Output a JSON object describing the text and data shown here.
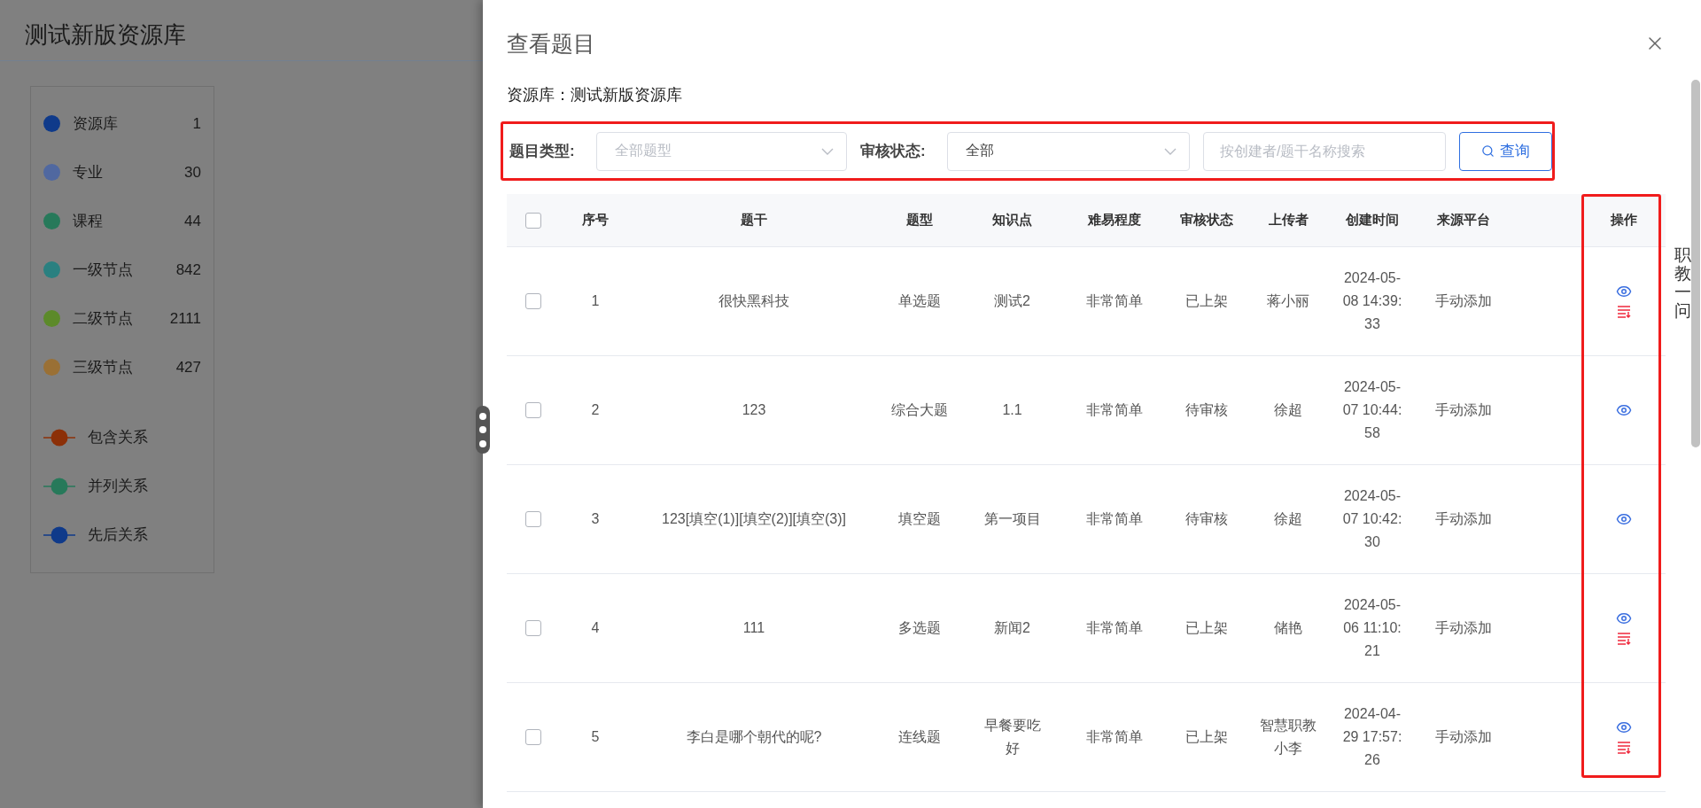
{
  "page": {
    "title": "测试新版资源库",
    "nodes": [
      {
        "label": "资源库",
        "count": "1",
        "color": "#0f3a8a"
      },
      {
        "label": "专业",
        "count": "30",
        "color": "#5068a0"
      },
      {
        "label": "课程",
        "count": "44",
        "color": "#27795a"
      },
      {
        "label": "一级节点",
        "count": "842",
        "color": "#2a8080"
      },
      {
        "label": "二级节点",
        "count": "2111",
        "color": "#5c8a2a"
      },
      {
        "label": "三级节点",
        "count": "427",
        "color": "#9a7035"
      }
    ],
    "relations": [
      {
        "label": "包含关系",
        "color": "#8c3008"
      },
      {
        "label": "并列关系",
        "color": "#27795a"
      },
      {
        "label": "先后关系",
        "color": "#0f3a8a"
      }
    ]
  },
  "drawer": {
    "title": "查看题目",
    "library": "资源库：测试新版资源库",
    "filters": {
      "highlighted": true,
      "type_label": "题目类型:",
      "type_placeholder": "全部题型",
      "status_label": "审核状态:",
      "status_value": "全部",
      "search_placeholder": "按创建者/题干名称搜索",
      "search_button": "查询"
    },
    "table": {
      "actions_highlighted": true,
      "select_all": {
        "checked": false
      },
      "columns": [
        "序号",
        "题干",
        "题型",
        "知识点",
        "难易程度",
        "审核状态",
        "上传者",
        "创建时间",
        "来源平台",
        "操作"
      ],
      "rows": [
        {
          "checked": false,
          "index": "1",
          "stem": "很快黑科技",
          "type": "单选题",
          "knowledge": "测试2",
          "difficulty": "非常简单",
          "status": "已上架",
          "uploader": "蒋小丽",
          "created": "2024-05-08 14:39:33",
          "source": "手动添加",
          "actions": [
            {
              "kind": "view"
            },
            {
              "kind": "unpublish"
            }
          ]
        },
        {
          "checked": false,
          "index": "2",
          "stem": "123",
          "type": "综合大题",
          "knowledge": "1.1",
          "difficulty": "非常简单",
          "status": "待审核",
          "uploader": "徐超",
          "created": "2024-05-07 10:44:58",
          "source": "手动添加",
          "actions": [
            {
              "kind": "view"
            }
          ]
        },
        {
          "checked": false,
          "index": "3",
          "stem": "123[填空(1)][填空(2)][填空(3)]",
          "type": "填空题",
          "knowledge": "第一项目",
          "difficulty": "非常简单",
          "status": "待审核",
          "uploader": "徐超",
          "created": "2024-05-07 10:42:30",
          "source": "手动添加",
          "actions": [
            {
              "kind": "view"
            }
          ]
        },
        {
          "checked": false,
          "index": "4",
          "stem": "111",
          "type": "多选题",
          "knowledge": "新闻2",
          "difficulty": "非常简单",
          "status": "已上架",
          "uploader": "储艳",
          "created": "2024-05-06 11:10:21",
          "source": "手动添加",
          "actions": [
            {
              "kind": "view"
            },
            {
              "kind": "unpublish"
            }
          ]
        },
        {
          "checked": false,
          "index": "5",
          "stem": "李白是哪个朝代的呢?",
          "type": "连线题",
          "knowledge": "早餐要吃好",
          "difficulty": "非常简单",
          "status": "已上架",
          "uploader": "智慧职教小李",
          "created": "2024-04-29 17:57:26",
          "source": "手动添加",
          "actions": [
            {
              "kind": "view"
            },
            {
              "kind": "unpublish"
            }
          ]
        }
      ]
    },
    "side_text": "职教一问"
  }
}
